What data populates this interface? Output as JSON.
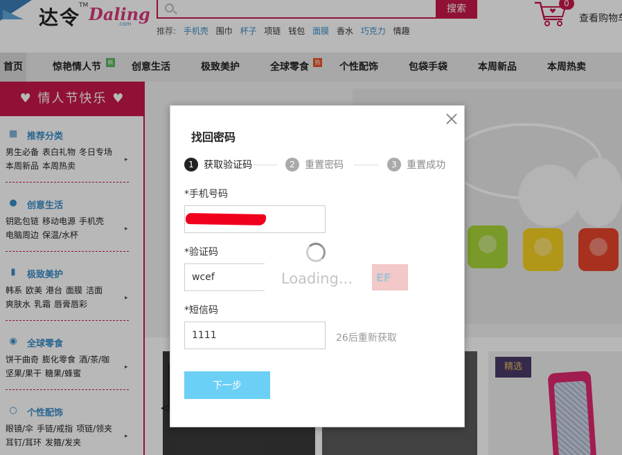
{
  "header": {
    "logo_cn": "达令",
    "logo_en": "Daling",
    "logo_tm": "TM",
    "logo_com": ".com",
    "search_placeholder": "",
    "search_button": "搜索",
    "hot_words_label": "推荐:",
    "hot_words": [
      "手机壳",
      "围巾",
      "杯子",
      "项链",
      "钱包",
      "面膜",
      "香水",
      "巧克力",
      "情趣"
    ],
    "cart_count": "0",
    "cart_label": "查看购物车"
  },
  "nav": {
    "items": [
      "首页",
      "惊艳情人节",
      "创意生活",
      "极致美护",
      "全球零食",
      "个性配饰",
      "包袋手袋",
      "本周新品",
      "本周热卖"
    ],
    "tag_hot": "热",
    "tag_new": "新"
  },
  "sidebar": {
    "title": "♥ 情人节快乐 ♥",
    "categories": [
      {
        "title": "推荐分类",
        "links": [
          "男生必备",
          "表白礼物",
          "冬日专场",
          "本周新品",
          "本周热卖"
        ]
      },
      {
        "title": "创意生活",
        "links": [
          "钥匙包链",
          "移动电源",
          "手机壳",
          "电脑周边",
          "保温/水杯"
        ]
      },
      {
        "title": "极致美护",
        "links": [
          "韩系",
          "欧美",
          "港台",
          "面膜",
          "洁面",
          "爽肤水",
          "乳霜",
          "唇膏唇彩"
        ]
      },
      {
        "title": "全球零食",
        "links": [
          "饼干曲奇",
          "膨化零食",
          "酒/茶/咖",
          "坚果/果干",
          "糖果/蜂蜜"
        ]
      },
      {
        "title": "个性配饰",
        "links": [
          "眼镜/伞",
          "手链/戒指",
          "项链/领夹",
          "耳钉/耳环",
          "发箍/发夹"
        ]
      }
    ]
  },
  "main": {
    "card_tag": "精选",
    "prev_arrow": "<"
  },
  "modal": {
    "title": "找回密码",
    "steps": [
      {
        "num": "1",
        "label": "获取验证码"
      },
      {
        "num": "2",
        "label": "重置密码"
      },
      {
        "num": "3",
        "label": "重置成功"
      }
    ],
    "phone_label": "*手机号码",
    "phone_value": "",
    "captcha_label": "*验证码",
    "captcha_value": "wcef",
    "captcha_image_text": "EF",
    "loading_text": "Loading...",
    "sms_label": "*短信码",
    "sms_value": "1111",
    "resend_text": "26后重新获取",
    "next_button": "下一步"
  },
  "colors": {
    "brand": "#c8184a",
    "step_active": "#222222",
    "step_inactive": "#aaaaaa",
    "next_button": "#6ccff6"
  }
}
